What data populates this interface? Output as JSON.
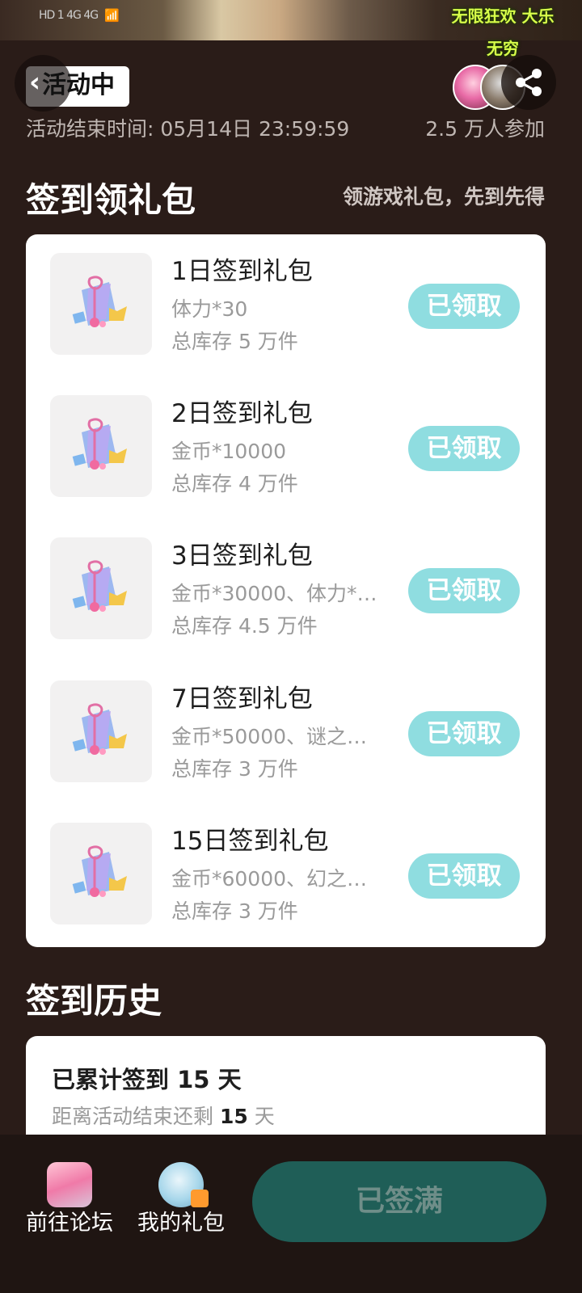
{
  "status_bar": {
    "left_text": "HD 1  4G  4G",
    "game_logo_text": "无限狂欢 大乐无穷"
  },
  "header": {
    "title": "活动中",
    "end_time": "活动结束时间: 05月14日 23:59:59",
    "participants": "2.5 万人参加"
  },
  "checkin": {
    "title": "签到领礼包",
    "subtitle": "领游戏礼包，先到先得",
    "gifts": [
      {
        "name": "1日签到礼包",
        "content": "体力*30",
        "stock": "总库存 5 万件",
        "button": "已领取"
      },
      {
        "name": "2日签到礼包",
        "content": "金币*10000",
        "stock": "总库存 4 万件",
        "button": "已领取"
      },
      {
        "name": "3日签到礼包",
        "content": "金币*30000、体力*…",
        "stock": "总库存 4.5 万件",
        "button": "已领取"
      },
      {
        "name": "7日签到礼包",
        "content": "金币*50000、谜之…",
        "stock": "总库存 3 万件",
        "button": "已领取"
      },
      {
        "name": "15日签到礼包",
        "content": "金币*60000、幻之…",
        "stock": "总库存 3 万件",
        "button": "已领取"
      }
    ]
  },
  "history": {
    "title": "签到历史",
    "line1_prefix": "已累计签到 ",
    "line1_days": "15",
    "line1_suffix": " 天",
    "line2_prefix": "距离活动结束还剩 ",
    "line2_days": "15",
    "line2_suffix": " 天"
  },
  "bottom_nav": {
    "forum_label": "前往论坛",
    "mygift_label": "我的礼包",
    "main_button": "已签满"
  },
  "colors": {
    "background": "#2a1c18",
    "claimed_button": "#8fdde0",
    "main_button": "#1f5e57"
  }
}
